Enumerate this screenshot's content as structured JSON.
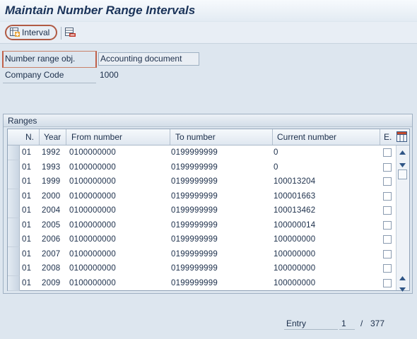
{
  "window": {
    "title": "Maintain Number Range Intervals"
  },
  "toolbar": {
    "interval_label": "Interval"
  },
  "header_fields": {
    "number_range_obj": {
      "label": "Number range obj.",
      "value": "Accounting document"
    },
    "company_code": {
      "label": "Company Code",
      "value": "1000"
    }
  },
  "ranges": {
    "group_title": "Ranges",
    "columns": {
      "n": "N.",
      "year": "Year",
      "from": "From number",
      "to": "To number",
      "current": "Current number",
      "ext": "E."
    },
    "rows": [
      {
        "n": "01",
        "year": "1992",
        "from": "0100000000",
        "to": "0199999999",
        "current": "0"
      },
      {
        "n": "01",
        "year": "1993",
        "from": "0100000000",
        "to": "0199999999",
        "current": "0"
      },
      {
        "n": "01",
        "year": "1999",
        "from": "0100000000",
        "to": "0199999999",
        "current": "100013204"
      },
      {
        "n": "01",
        "year": "2000",
        "from": "0100000000",
        "to": "0199999999",
        "current": "100001663"
      },
      {
        "n": "01",
        "year": "2004",
        "from": "0100000000",
        "to": "0199999999",
        "current": "100013462"
      },
      {
        "n": "01",
        "year": "2005",
        "from": "0100000000",
        "to": "0199999999",
        "current": "100000014"
      },
      {
        "n": "01",
        "year": "2006",
        "from": "0100000000",
        "to": "0199999999",
        "current": "100000000"
      },
      {
        "n": "01",
        "year": "2007",
        "from": "0100000000",
        "to": "0199999999",
        "current": "100000000"
      },
      {
        "n": "01",
        "year": "2008",
        "from": "0100000000",
        "to": "0199999999",
        "current": "100000000"
      },
      {
        "n": "01",
        "year": "2009",
        "from": "0100000000",
        "to": "0199999999",
        "current": "100000000"
      }
    ]
  },
  "entry": {
    "label": "Entry",
    "current": "1",
    "separator": "/",
    "total": "377"
  },
  "icons": {
    "interval": "create-interval-icon",
    "delete": "delete-interval-icon",
    "settings": "table-settings-icon",
    "scroll_up": "scroll-up-icon",
    "scroll_down": "scroll-down-icon"
  },
  "colors": {
    "highlight_oval": "#b05a44",
    "title": "#1a3359"
  }
}
